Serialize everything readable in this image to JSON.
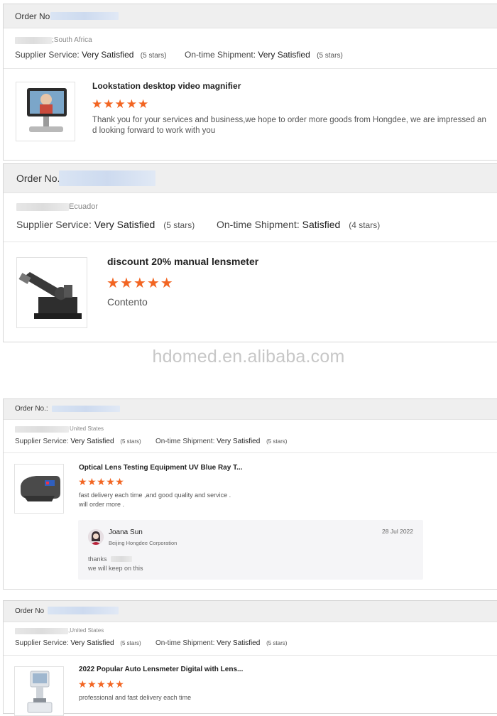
{
  "watermark": "hdomed.en.alibaba.com",
  "orders": [
    {
      "order_label": "Order No",
      "location": ";South Africa",
      "supplier_service_label": "Supplier Service:",
      "supplier_service_value": "Very Satisfied",
      "supplier_service_stars": "(5 stars)",
      "shipment_label": "On-time Shipment:",
      "shipment_value": "Very Satisfied",
      "shipment_stars": "(5 stars)",
      "product_title": "Lookstation desktop video magnifier",
      "rating": 5,
      "review": "Thank you for your services and business,we hope to order more goods from Hongdee, we are impressed and looking forward to work with you"
    },
    {
      "order_label": "Order No.",
      "location": "Ecuador",
      "supplier_service_label": "Supplier Service:",
      "supplier_service_value": "Very Satisfied",
      "supplier_service_stars": "(5 stars)",
      "shipment_label": "On-time Shipment:",
      "shipment_value": "Satisfied",
      "shipment_stars": "(4 stars)",
      "product_title": "discount 20% manual lensmeter",
      "rating": 5,
      "review": "Contento"
    },
    {
      "order_label": "Order No.:",
      "location": "United States",
      "supplier_service_label": "Supplier Service:",
      "supplier_service_value": "Very Satisfied",
      "supplier_service_stars": "(5 stars)",
      "shipment_label": "On-time Shipment:",
      "shipment_value": "Very Satisfied",
      "shipment_stars": "(5 stars)",
      "product_title": "Optical Lens Testing Equipment UV Blue Ray T...",
      "rating": 5,
      "review_line1": "fast delivery each time ,and good quality and service .",
      "review_line2": "will order more .",
      "reply": {
        "name": "Joana Sun",
        "company": "Beijing Hongdee Corporation",
        "date": "28 Jul 2022",
        "line1": "thanks",
        "line2": "we will keep on this"
      }
    },
    {
      "order_label": "Order No",
      "location": ",United States",
      "supplier_service_label": "Supplier Service:",
      "supplier_service_value": "Very Satisfied",
      "supplier_service_stars": "(5 stars)",
      "shipment_label": "On-time Shipment:",
      "shipment_value": "Very Satisfied",
      "shipment_stars": "(5 stars)",
      "product_title": "2022 Popular Auto Lensmeter Digital with Lens...",
      "rating": 5,
      "review": "professional and fast delivery each time"
    }
  ],
  "colors": {
    "star": "#f26522",
    "header_bg": "#efefef"
  },
  "star_glyph": "★"
}
